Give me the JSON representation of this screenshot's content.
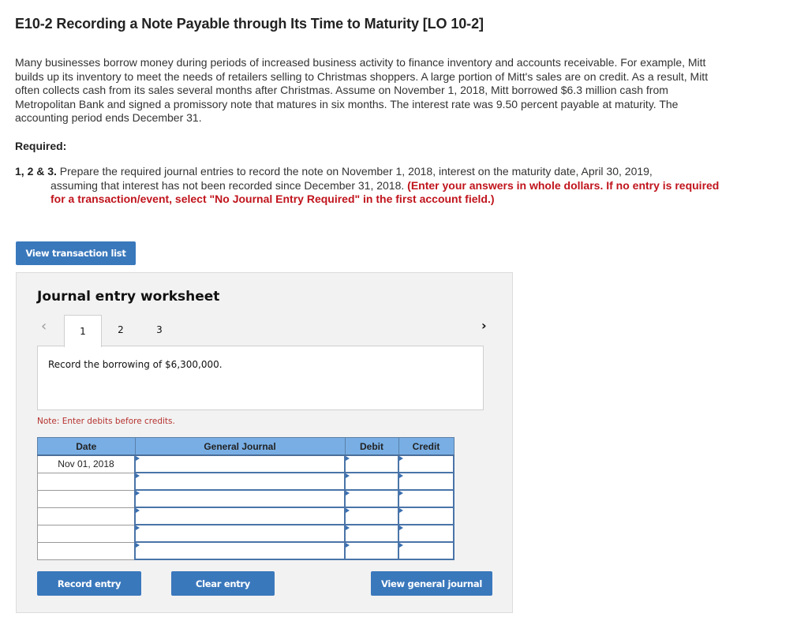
{
  "header": {
    "title": "E10-2 Recording a Note Payable through Its Time to Maturity [LO 10-2]"
  },
  "problem": {
    "paragraph": "Many businesses borrow money during periods of increased business activity to finance inventory and accounts receivable. For example, Mitt builds up its inventory to meet the needs of retailers selling to Christmas shoppers. A large portion of Mitt's sales are on credit. As a result, Mitt often collects cash from its sales several months after Christmas. Assume on November 1, 2018, Mitt borrowed $6.3 million cash from Metropolitan Bank and signed a promissory note that matures in six months. The interest rate was 9.50 percent payable at maturity. The accounting period ends December 31.",
    "required_label": "Required:",
    "instruction_number": "1, 2 & 3.",
    "instruction_text_line1": " Prepare the required journal entries to record the note on November 1, 2018, interest on the maturity date, April 30, 2019,",
    "instruction_text_line2": "assuming that interest has not been recorded since December 31, 2018. ",
    "instruction_red": "(Enter your answers in whole dollars. If no entry is required for a transaction/event, select \"No Journal Entry Required\" in the first account field.)"
  },
  "buttons": {
    "view_transaction_list": "View transaction list",
    "record_entry": "Record entry",
    "clear_entry": "Clear entry",
    "view_general_journal": "View general journal"
  },
  "worksheet": {
    "title": "Journal entry worksheet",
    "prev_icon": "‹",
    "next_icon": "›",
    "tabs": [
      {
        "label": "1",
        "active": true
      },
      {
        "label": "2",
        "active": false
      },
      {
        "label": "3",
        "active": false
      }
    ],
    "description": "Record the borrowing of $6,300,000.",
    "note": "Note: Enter debits before credits.",
    "table": {
      "headers": [
        "Date",
        "General Journal",
        "Debit",
        "Credit"
      ],
      "rows": [
        {
          "date": "Nov 01, 2018",
          "account": "",
          "debit": "",
          "credit": ""
        },
        {
          "date": "",
          "account": "",
          "debit": "",
          "credit": ""
        },
        {
          "date": "",
          "account": "",
          "debit": "",
          "credit": ""
        },
        {
          "date": "",
          "account": "",
          "debit": "",
          "credit": ""
        },
        {
          "date": "",
          "account": "",
          "debit": "",
          "credit": ""
        },
        {
          "date": "",
          "account": "",
          "debit": "",
          "credit": ""
        }
      ]
    }
  },
  "colors": {
    "button_blue": "#3a78bc",
    "header_blue": "#78aee4",
    "instruction_red": "#c0141c",
    "note_red": "#b5322e"
  }
}
